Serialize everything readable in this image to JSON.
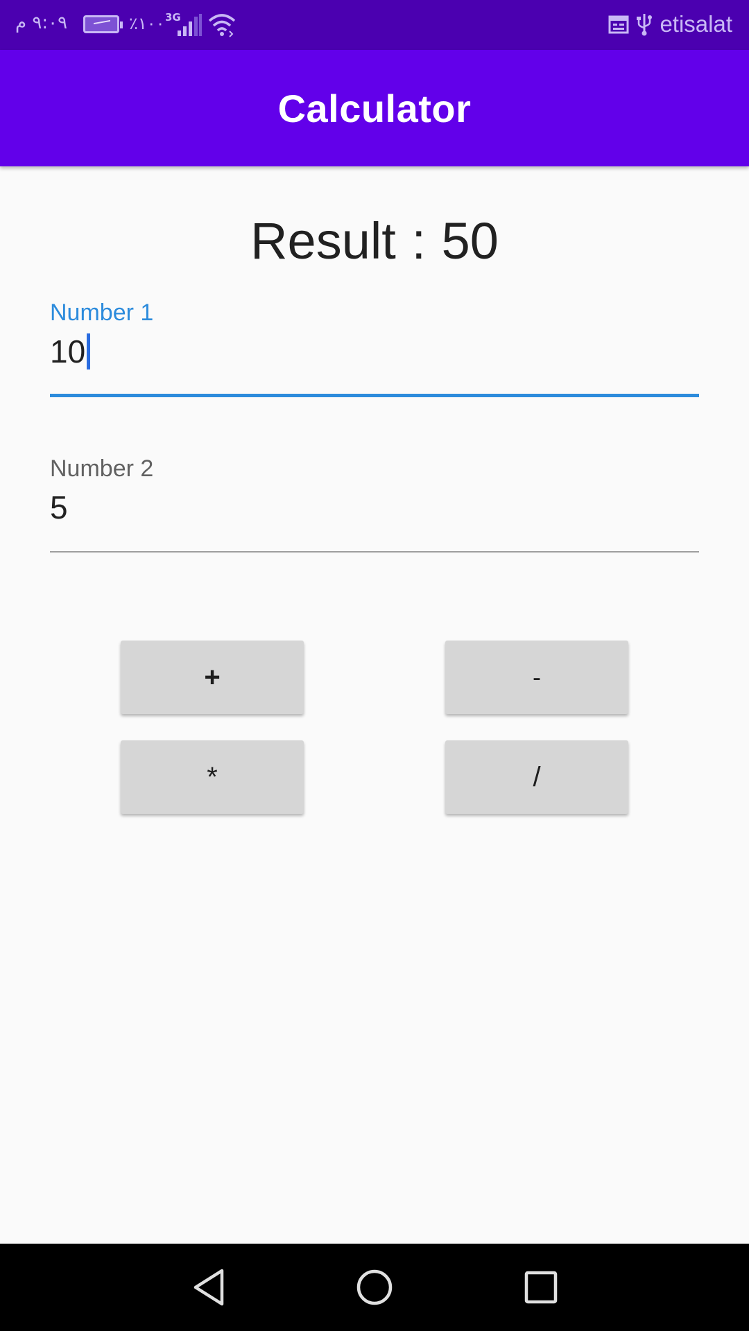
{
  "status_bar": {
    "time": "٩:٠٩ م",
    "battery_text": "٪١٠٠",
    "network_type": "3G",
    "carrier": "etisalat",
    "icons": [
      "battery-charging-icon",
      "signal-icon",
      "wifi-icon",
      "calendar-icon",
      "usb-icon"
    ]
  },
  "app_bar": {
    "title": "Calculator"
  },
  "result": {
    "label": "Result",
    "separator": ":",
    "value": "50"
  },
  "field1": {
    "label": "Number 1",
    "value": "10",
    "focused": true
  },
  "field2": {
    "label": "Number 2",
    "value": "5",
    "focused": false
  },
  "buttons": {
    "add": "+",
    "subtract": "-",
    "multiply": "*",
    "divide": "/"
  },
  "nav_bar": {
    "icons": [
      "back-icon",
      "home-icon",
      "recents-icon"
    ]
  },
  "colors": {
    "status_bar": "#4b00b0",
    "app_bar": "#6200ea",
    "accent": "#2c8bdc",
    "button": "#d6d6d6",
    "background": "#fafafa"
  }
}
